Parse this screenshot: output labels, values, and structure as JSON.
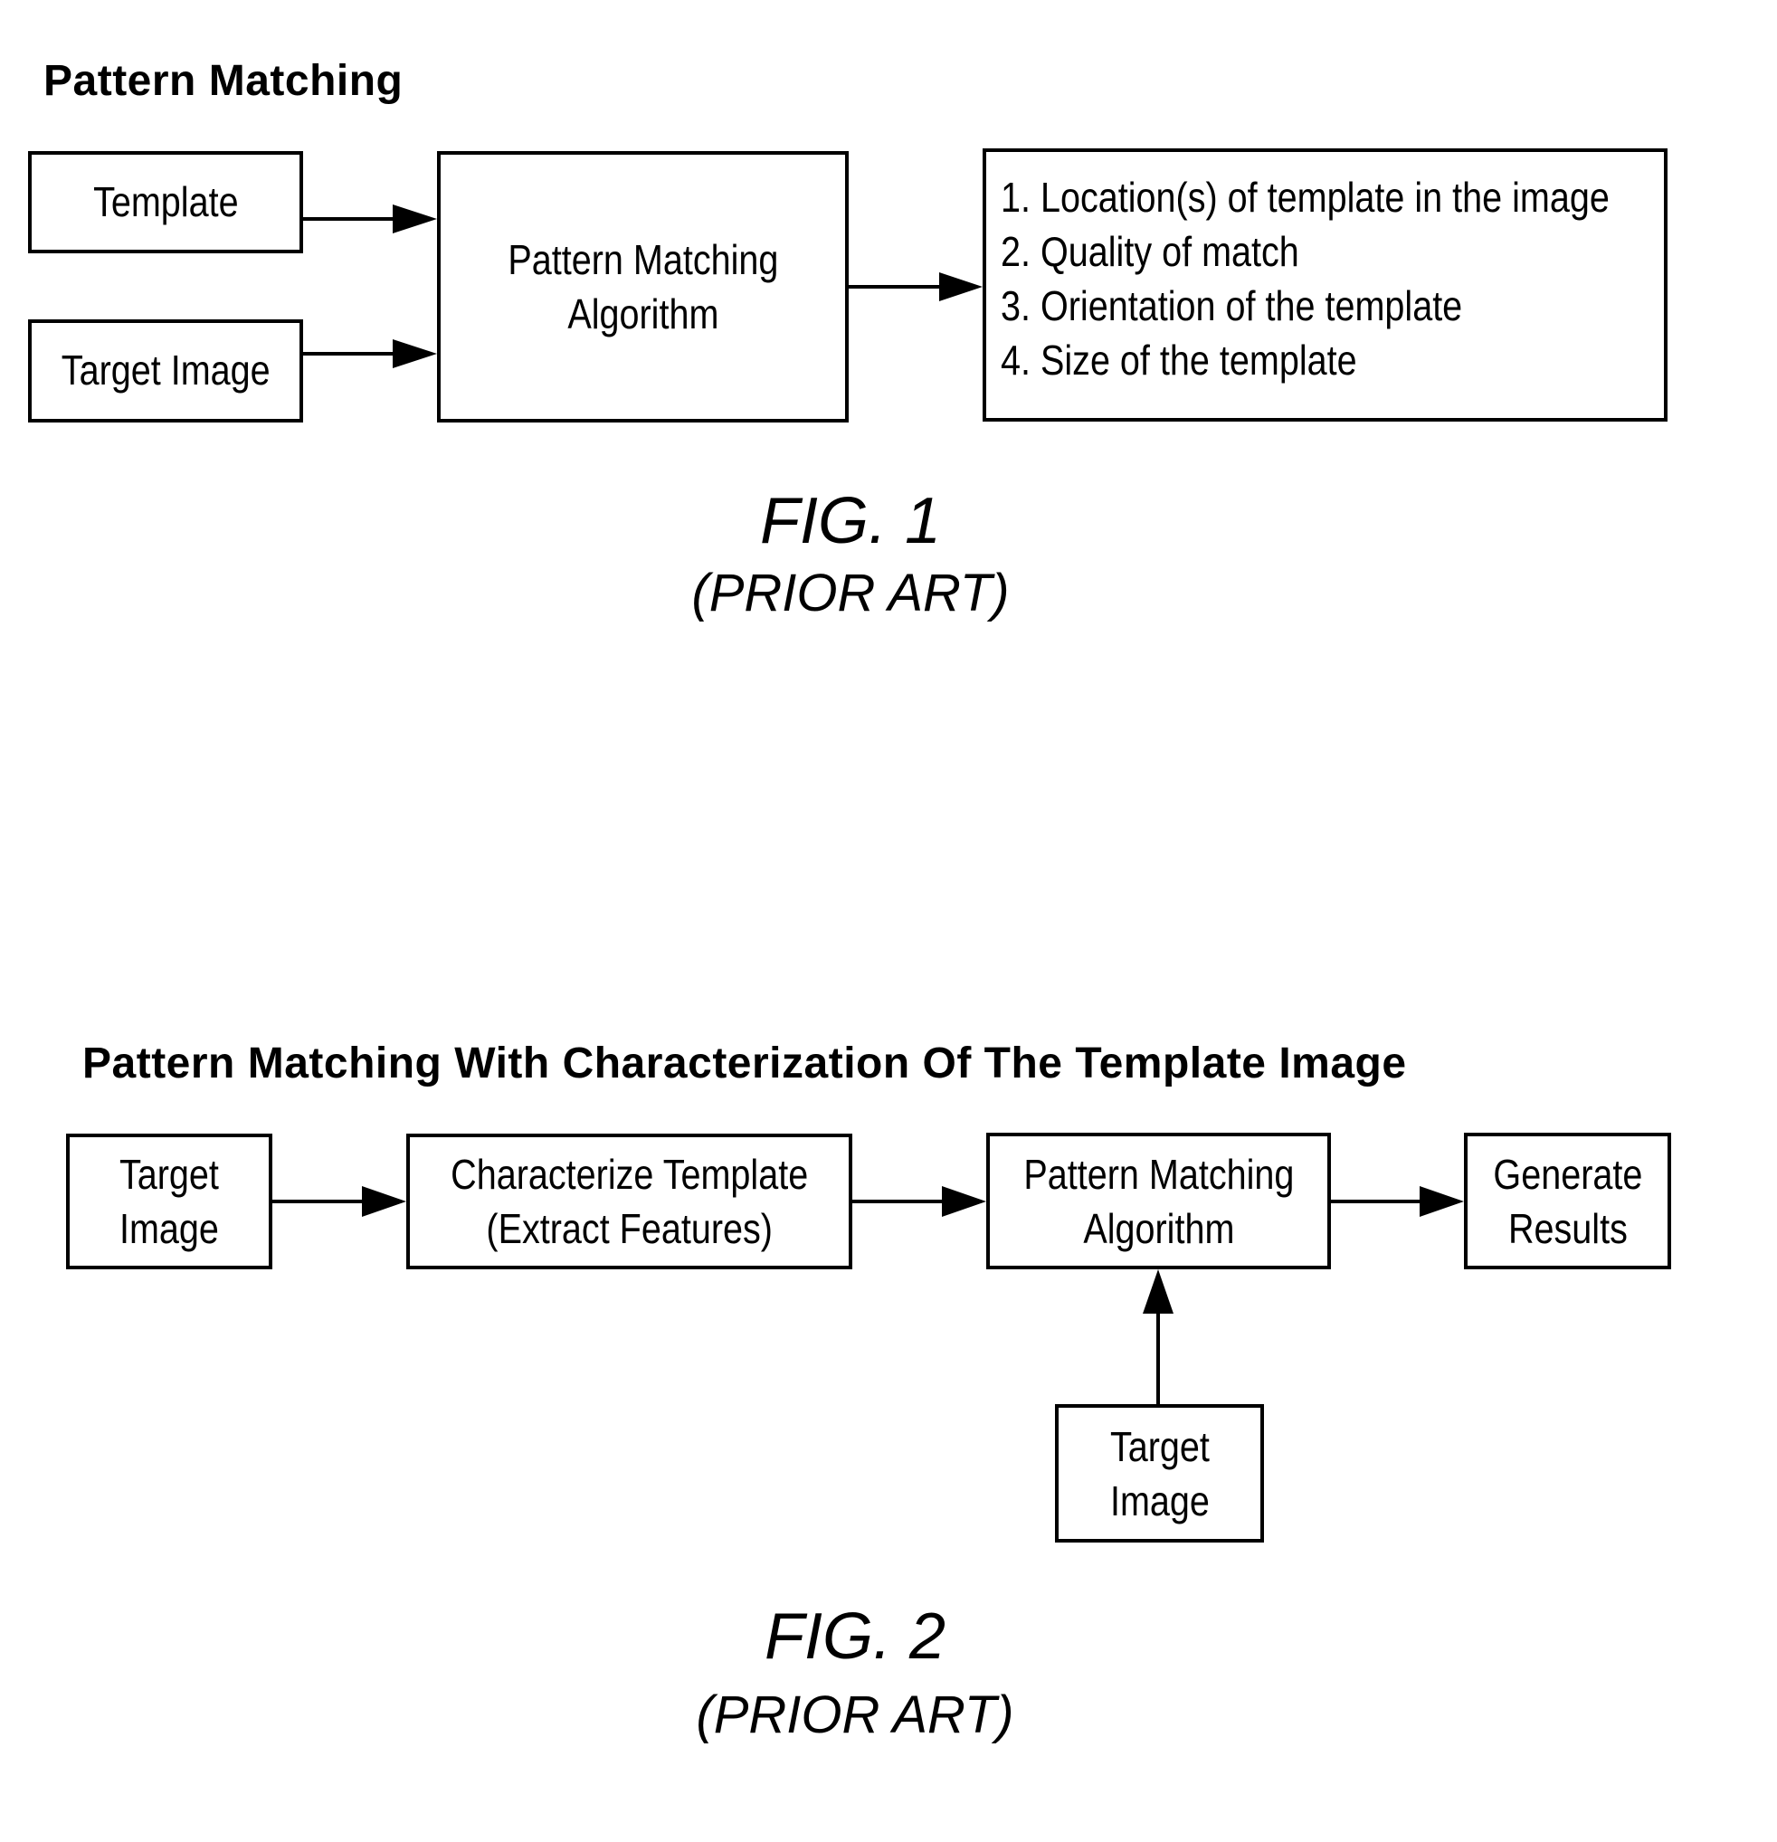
{
  "figure1": {
    "title": "Pattern Matching",
    "boxes": {
      "template": "Template",
      "target_image": "Target Image",
      "algorithm": "Pattern  Matching\nAlgorithm"
    },
    "results": [
      "1. Location(s) of template in the image",
      "2. Quality of match",
      "3. Orientation of the template",
      "4. Size of the template"
    ],
    "label": "FIG. 1",
    "sublabel": "(PRIOR ART)"
  },
  "figure2": {
    "title": "Pattern Matching With Characterization Of The Template Image",
    "boxes": {
      "target_image": "Target\nImage",
      "characterize": "Characterize Template\n(Extract Features)",
      "algorithm": "Pattern Matching\nAlgorithm",
      "generate": "Generate\nResults",
      "target_image_bottom": "Target\nImage"
    },
    "label": "FIG. 2",
    "sublabel": "(PRIOR ART)"
  }
}
